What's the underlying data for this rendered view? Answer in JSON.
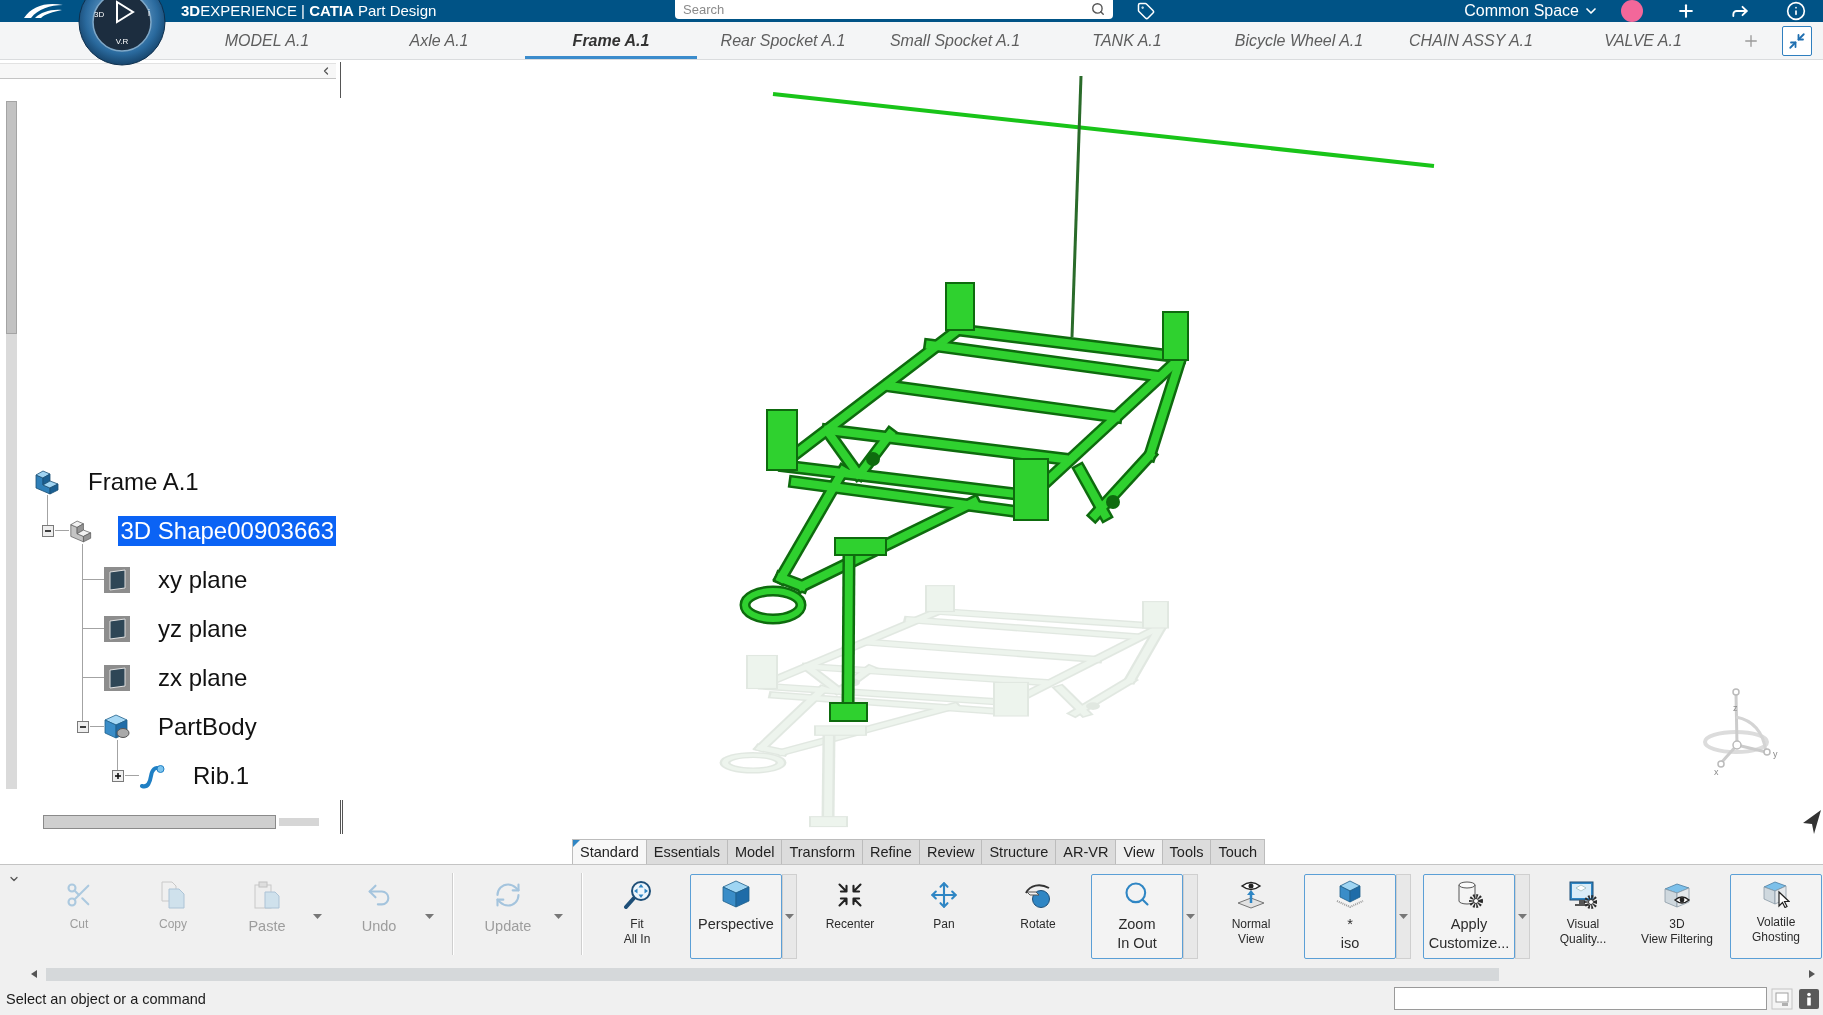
{
  "top_bar": {
    "title": "**3D**EXPERIENCE | **CATIA** Part Design",
    "search": {
      "placeholder": "Search"
    },
    "space": "Common Space"
  },
  "compass": {
    "labels": [
      "3D",
      "V.R",
      "i"
    ]
  },
  "document_tabs": [
    {
      "label": "MODEL A.1",
      "selected": false
    },
    {
      "label": "Axle A.1",
      "selected": false
    },
    {
      "label": "Frame A.1",
      "selected": true
    },
    {
      "label": "Rear Spocket A.1",
      "selected": false
    },
    {
      "label": "Small Spocket A.1",
      "selected": false
    },
    {
      "label": "TANK A.1",
      "selected": false
    },
    {
      "label": "Bicycle Wheel A.1",
      "selected": false
    },
    {
      "label": "CHAIN ASSY A.1",
      "selected": false
    },
    {
      "label": "VALVE A.1",
      "selected": false
    }
  ],
  "tree": [
    {
      "label": "Frame A.1",
      "kind": "product",
      "selected": false,
      "children": [
        {
          "label": "3D Shape00903663",
          "kind": "shape",
          "selected": true,
          "expanded": true,
          "children": [
            {
              "label": "xy plane",
              "kind": "plane",
              "selected": false
            },
            {
              "label": "yz plane",
              "kind": "plane",
              "selected": false
            },
            {
              "label": "zx plane",
              "kind": "plane",
              "selected": false
            },
            {
              "label": "PartBody",
              "kind": "body",
              "selected": false,
              "expanded": true,
              "children": [
                {
                  "label": "Rib.1",
                  "kind": "rib",
                  "selected": false,
                  "expanded": false
                }
              ]
            }
          ]
        }
      ]
    }
  ],
  "viewport": {
    "axis_labels": [
      "z",
      "x",
      "y"
    ]
  },
  "toolbar_tabs": [
    {
      "label": "Standard",
      "selected": true,
      "highlighted": false
    },
    {
      "label": "Essentials",
      "selected": false,
      "highlighted": false
    },
    {
      "label": "Model",
      "selected": false,
      "highlighted": false
    },
    {
      "label": "Transform",
      "selected": false,
      "highlighted": false
    },
    {
      "label": "Refine",
      "selected": false,
      "highlighted": false
    },
    {
      "label": "Review",
      "selected": false,
      "highlighted": false
    },
    {
      "label": "Structure",
      "selected": false,
      "highlighted": false
    },
    {
      "label": "AR-VR",
      "selected": false,
      "highlighted": false
    },
    {
      "label": "View",
      "selected": false,
      "highlighted": true
    },
    {
      "label": "Tools",
      "selected": false,
      "highlighted": false
    },
    {
      "label": "Touch",
      "selected": false,
      "highlighted": false
    }
  ],
  "tool_groups": [
    [
      {
        "lines": [
          "Cut"
        ],
        "disabled": true,
        "dropdown": false,
        "framed": false
      },
      {
        "lines": [
          "Copy"
        ],
        "disabled": true,
        "dropdown": false,
        "framed": false
      },
      {
        "lines": [
          "Paste"
        ],
        "disabled": true,
        "dropdown": true,
        "framed": false
      },
      {
        "lines": [
          "Undo"
        ],
        "disabled": true,
        "dropdown": true,
        "framed": false
      }
    ],
    [
      {
        "lines": [
          "Update"
        ],
        "disabled": true,
        "dropdown": true,
        "framed": false
      }
    ],
    [
      {
        "lines": [
          "Fit",
          "All In"
        ],
        "disabled": false,
        "dropdown": false,
        "framed": false
      },
      {
        "lines": [
          "Perspective"
        ],
        "disabled": false,
        "dropdown": true,
        "framed": true
      },
      {
        "lines": [
          "Recenter"
        ],
        "disabled": false,
        "dropdown": false,
        "framed": false
      },
      {
        "lines": [
          "Pan"
        ],
        "disabled": false,
        "dropdown": false,
        "framed": false
      },
      {
        "lines": [
          "Rotate"
        ],
        "disabled": false,
        "dropdown": false,
        "framed": false
      },
      {
        "lines": [
          "Zoom",
          "In Out"
        ],
        "disabled": false,
        "dropdown": true,
        "framed": true
      },
      {
        "lines": [
          "Normal",
          "View"
        ],
        "disabled": false,
        "dropdown": false,
        "framed": false
      },
      {
        "lines": [
          "*",
          "iso"
        ],
        "disabled": false,
        "dropdown": true,
        "framed": true
      },
      {
        "lines": [
          "Apply",
          "Customize..."
        ],
        "disabled": false,
        "dropdown": true,
        "framed": true
      },
      {
        "lines": [
          "Visual",
          "Quality..."
        ],
        "disabled": false,
        "dropdown": false,
        "framed": false
      },
      {
        "lines": [
          "3D",
          "View Filtering"
        ],
        "disabled": false,
        "dropdown": false,
        "framed": false
      },
      {
        "lines": [
          "Volatile",
          "Ghosting"
        ],
        "disabled": false,
        "dropdown": false,
        "framed": true
      }
    ]
  ],
  "status_bar": {
    "message": "Select an object or a command"
  }
}
